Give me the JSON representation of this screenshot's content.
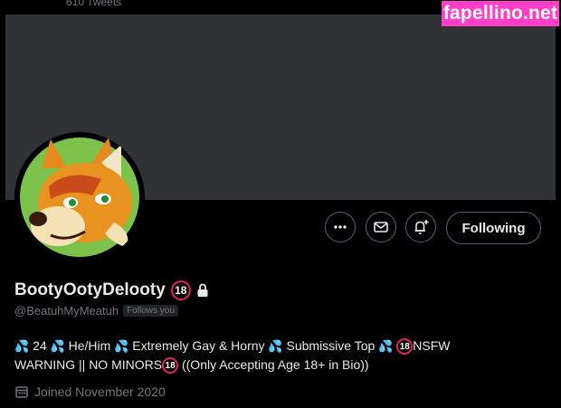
{
  "header": {
    "tweet_count": "610 Tweets"
  },
  "watermark": {
    "text": "fapellino.net"
  },
  "profile": {
    "display_name": "BootyOotyDelooty",
    "name_badge": "18",
    "handle": "@BeatuhMyMeatuh",
    "follows_you": "Follows you",
    "bio": {
      "line1": [
        {
          "type": "drops"
        },
        {
          "type": "text",
          "value": " 24 "
        },
        {
          "type": "drops"
        },
        {
          "type": "text",
          "value": " He/Him "
        },
        {
          "type": "drops"
        },
        {
          "type": "text",
          "value": " Extremely Gay & Horny "
        },
        {
          "type": "drops"
        },
        {
          "type": "text",
          "value": " Submissive Top "
        },
        {
          "type": "drops"
        },
        {
          "type": "text",
          "value": " "
        },
        {
          "type": "badge",
          "value": "18"
        },
        {
          "type": "text",
          "value": "NSFW"
        }
      ],
      "line2": [
        {
          "type": "text",
          "value": "WARNING || NO MINORS"
        },
        {
          "type": "badge",
          "value": "18"
        },
        {
          "type": "text",
          "value": " ((Only Accepting Age 18+ in Bio))"
        }
      ]
    },
    "joined": "Joined November 2020"
  },
  "actions": {
    "following_label": "Following"
  },
  "icons": {
    "more": "more-icon",
    "message": "mail-icon",
    "notifications": "bell-plus-icon",
    "lock": "lock-icon",
    "calendar": "calendar-icon",
    "drops": "sweat-droplets-icon"
  },
  "colors": {
    "background": "#000000",
    "banner": "#2f3336",
    "watermark": "#ff3ec9",
    "badge_ring": "#e0245e",
    "drops": "#3ab0ff",
    "muted_text": "#71767b"
  }
}
